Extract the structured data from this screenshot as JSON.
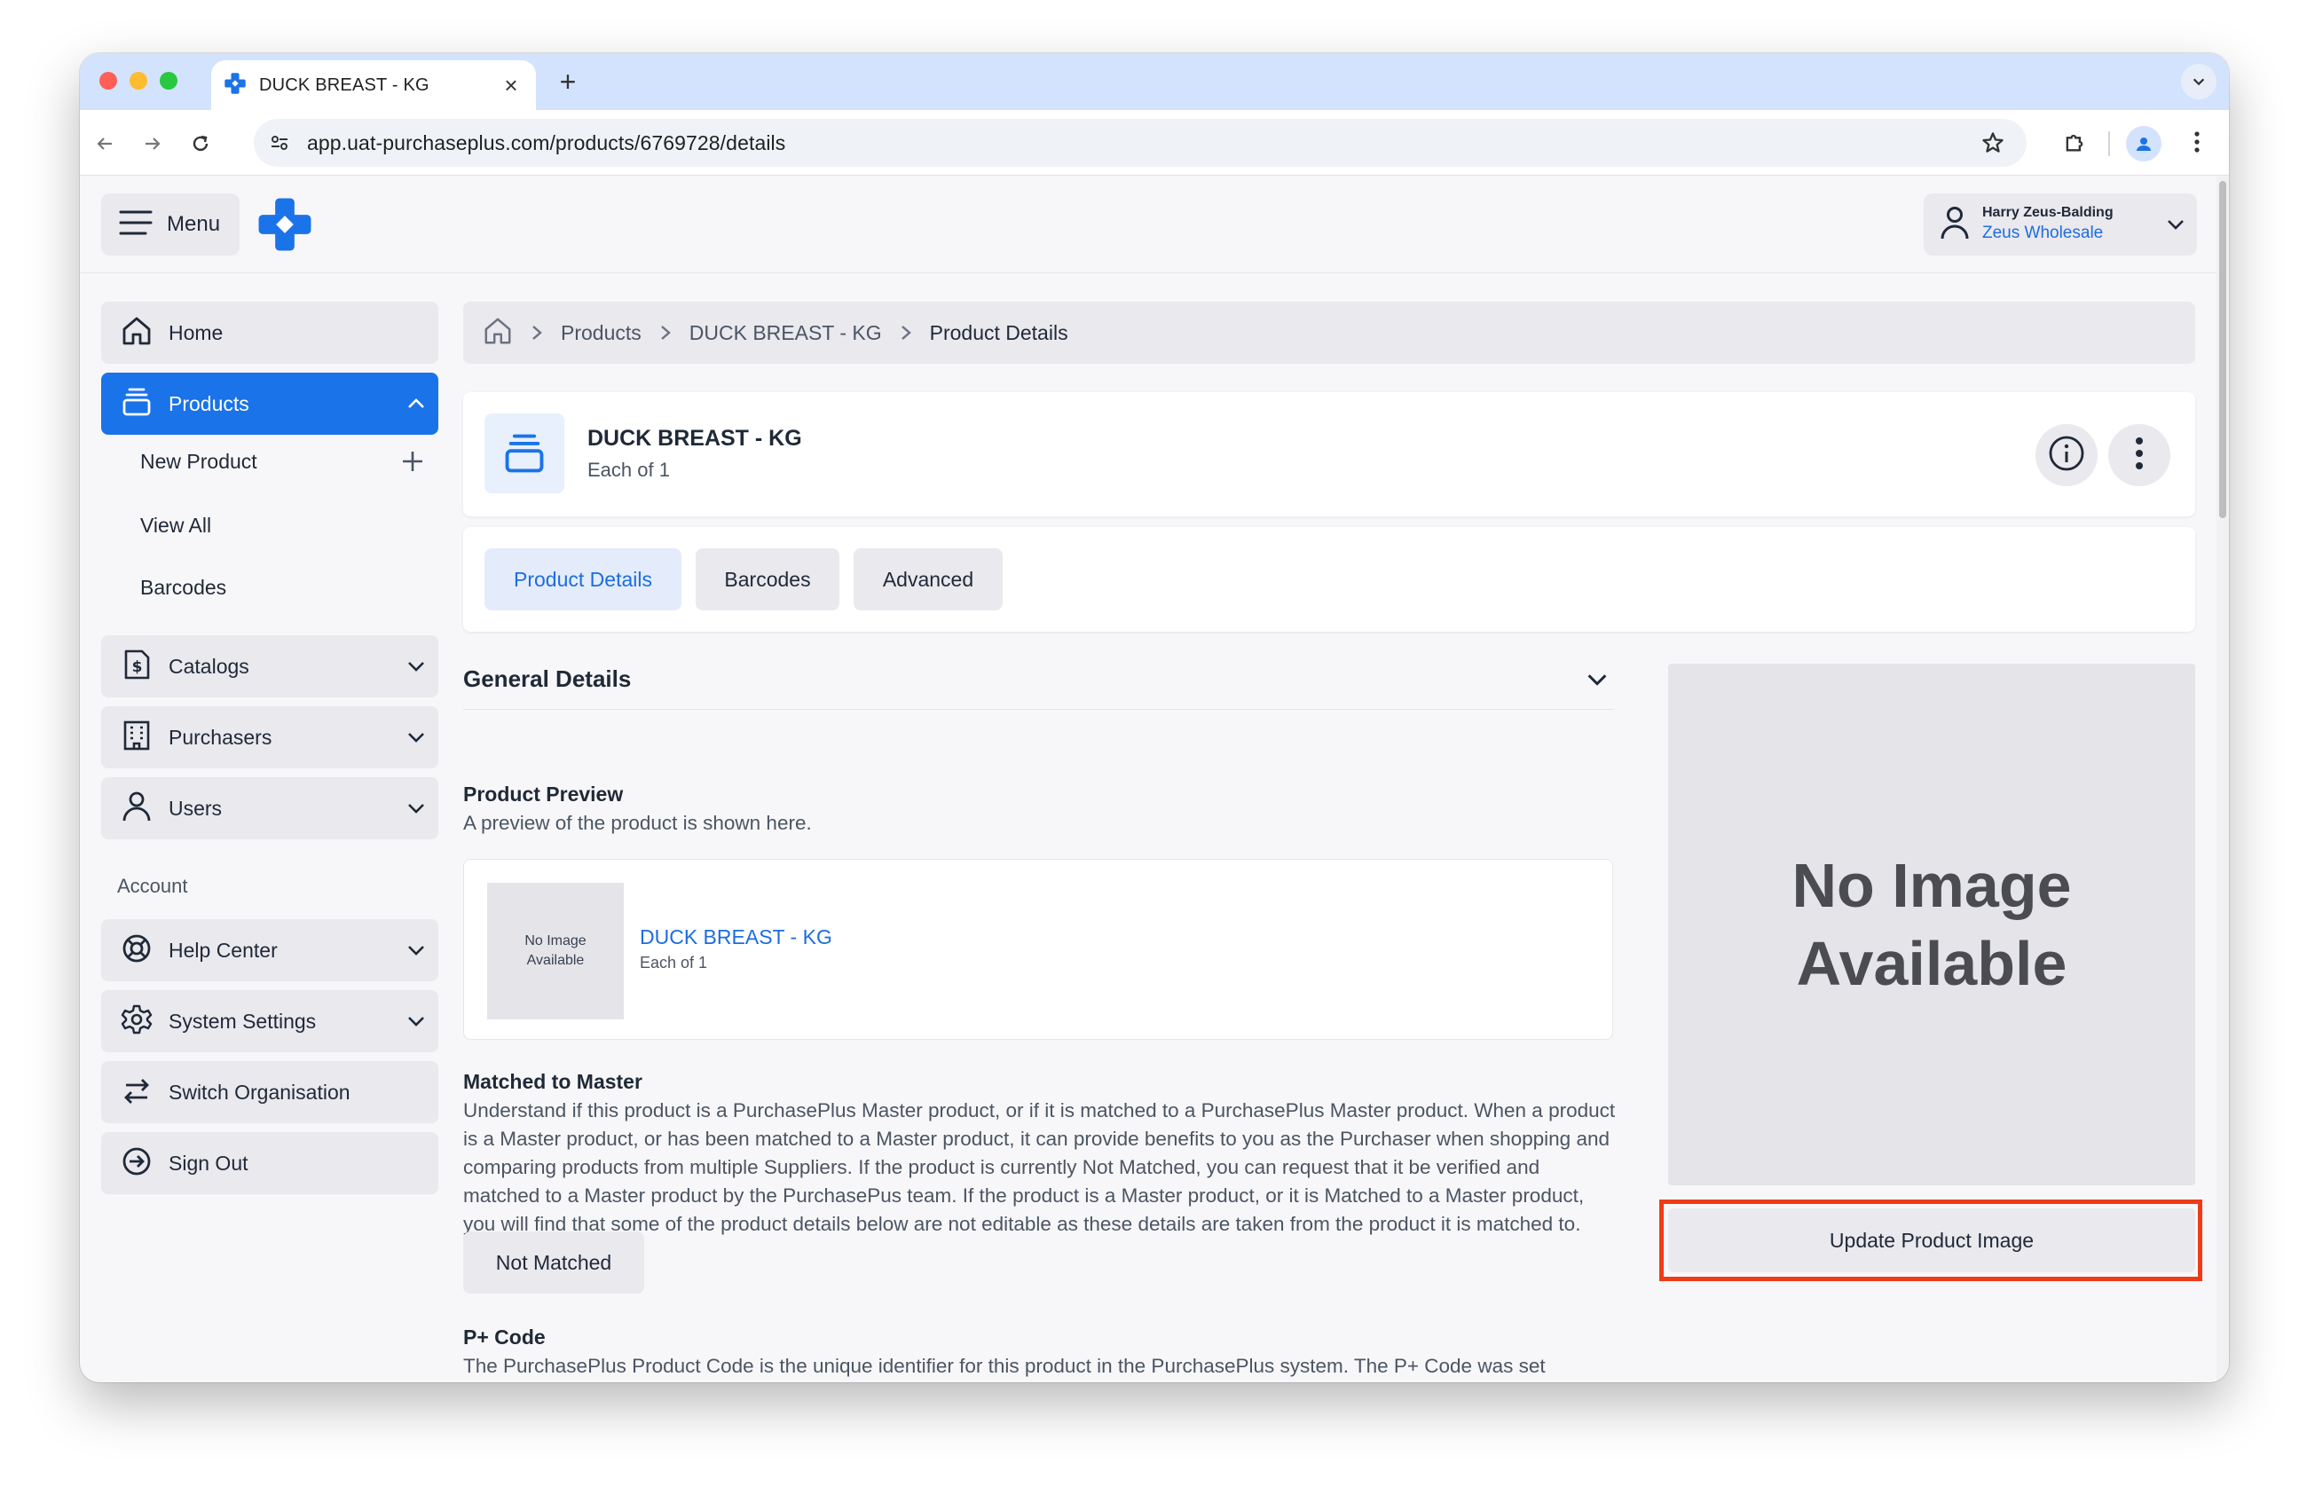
{
  "browser": {
    "tab_title": "DUCK BREAST - KG",
    "url": "app.uat-purchaseplus.com/products/6769728/details"
  },
  "header": {
    "menu_label": "Menu",
    "user_name": "Harry Zeus-Balding",
    "user_org": "Zeus Wholesale"
  },
  "sidebar": {
    "items": [
      {
        "label": "Home"
      },
      {
        "label": "Products"
      },
      {
        "label": "Catalogs"
      },
      {
        "label": "Purchasers"
      },
      {
        "label": "Users"
      }
    ],
    "product_sub": [
      {
        "label": "New Product"
      },
      {
        "label": "View All"
      },
      {
        "label": "Barcodes"
      }
    ],
    "account_label": "Account",
    "account_items": [
      {
        "label": "Help Center"
      },
      {
        "label": "System Settings"
      },
      {
        "label": "Switch Organisation"
      },
      {
        "label": "Sign Out"
      }
    ]
  },
  "breadcrumb": [
    "Products",
    "DUCK BREAST - KG",
    "Product Details"
  ],
  "product": {
    "name": "DUCK BREAST - KG",
    "unit": "Each of 1"
  },
  "tabs": [
    "Product Details",
    "Barcodes",
    "Advanced"
  ],
  "general": {
    "section_title": "General Details",
    "preview_title": "Product Preview",
    "preview_desc": "A preview of the product is shown here.",
    "preview_no_image": "No Image Available",
    "matched_title": "Matched to Master",
    "matched_desc": "Understand if this product is a PurchasePlus Master product, or if it is matched to a PurchasePlus Master product. When a product is a Master product, or has been matched to a Master product, it can provide benefits to you as the Purchaser when shopping and comparing products from multiple Suppliers. If the product is currently Not Matched, you can request that it be verified and matched to a Master product by the PurchasePus team. If the product is a Master product, or it is Matched to a Master product, you will find that some of the product details below are not editable as these details are taken from the product it is matched to.",
    "matched_button": "Not Matched",
    "pcode_title": "P+ Code",
    "pcode_desc": "The PurchasePlus Product Code is the unique identifier for this product in the PurchasePlus system. The P+ Code was set"
  },
  "image_panel": {
    "no_image": "No Image\nAvailable",
    "update_button": "Update Product Image"
  },
  "colors": {
    "accent": "#1a73e8",
    "highlight": "#ee3b18"
  }
}
